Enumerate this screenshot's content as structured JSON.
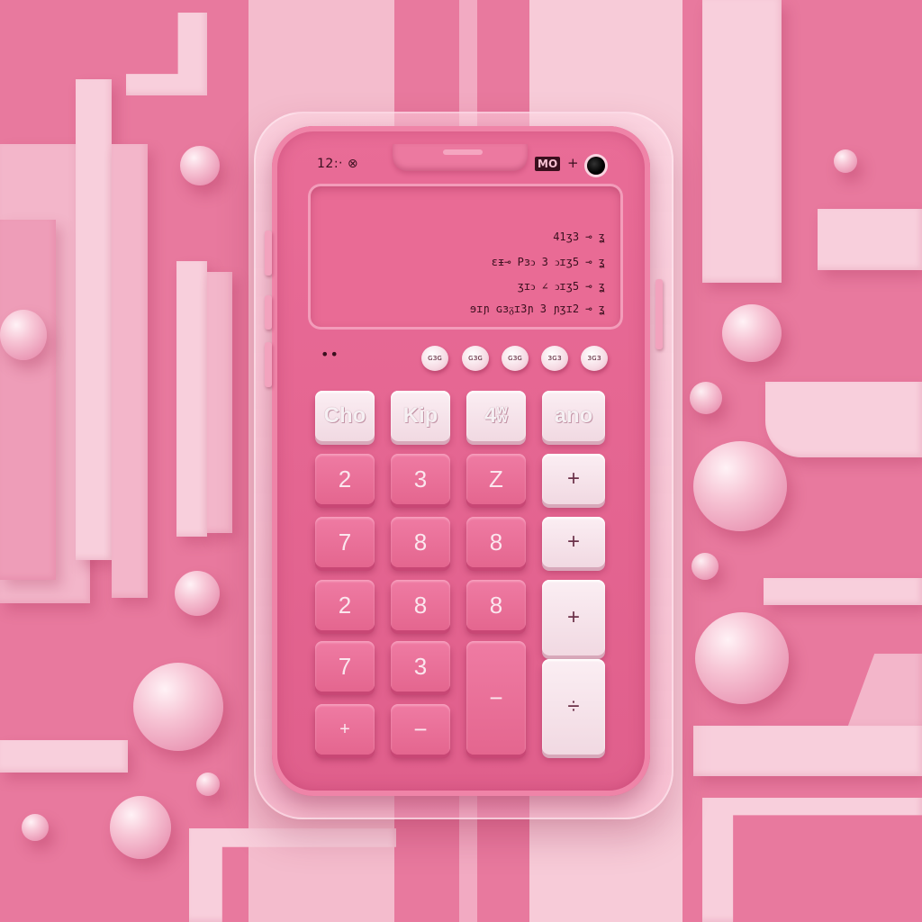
{
  "status": {
    "left": "12:‧ ⊗",
    "badge": "MO",
    "plus": "+"
  },
  "display": {
    "lines": [
      "41ʒ3 ⊸ ʓ",
      "ɛᵻ⊸ Pɜↄ 3 ↄɪʒ5 ⊸ ʓ",
      "ʒɪↄ ∠ ↄɪʒ5 ⊸ ʓ",
      "ɘɪɲ ɢɜᵹɪ3ɲ 3 ɲʒɪ2 ⊸ ʓ"
    ]
  },
  "indicator_dots": "••",
  "pills": [
    "ɢɜɢ",
    "ɢɜɢ",
    "ɢɜɢ",
    "ɜɢɜ",
    "ɜɢɜ"
  ],
  "keys": {
    "fn": [
      "Cho",
      "Kip",
      "4ʬ",
      "ano"
    ],
    "row1": [
      "2",
      "3",
      "Z",
      "+"
    ],
    "row2": [
      "7",
      "8",
      "8",
      "+"
    ],
    "row3": [
      "2",
      "8",
      "8",
      "+"
    ],
    "row4": [
      "7",
      "3",
      "−",
      "÷"
    ],
    "row5": [
      "+",
      "−"
    ]
  },
  "colors": {
    "background": "#e8799e",
    "device": "#e05f8c",
    "key_pink": "#ef7ba3",
    "key_white": "#fbeef3",
    "text_dark": "#3a0f1e"
  }
}
